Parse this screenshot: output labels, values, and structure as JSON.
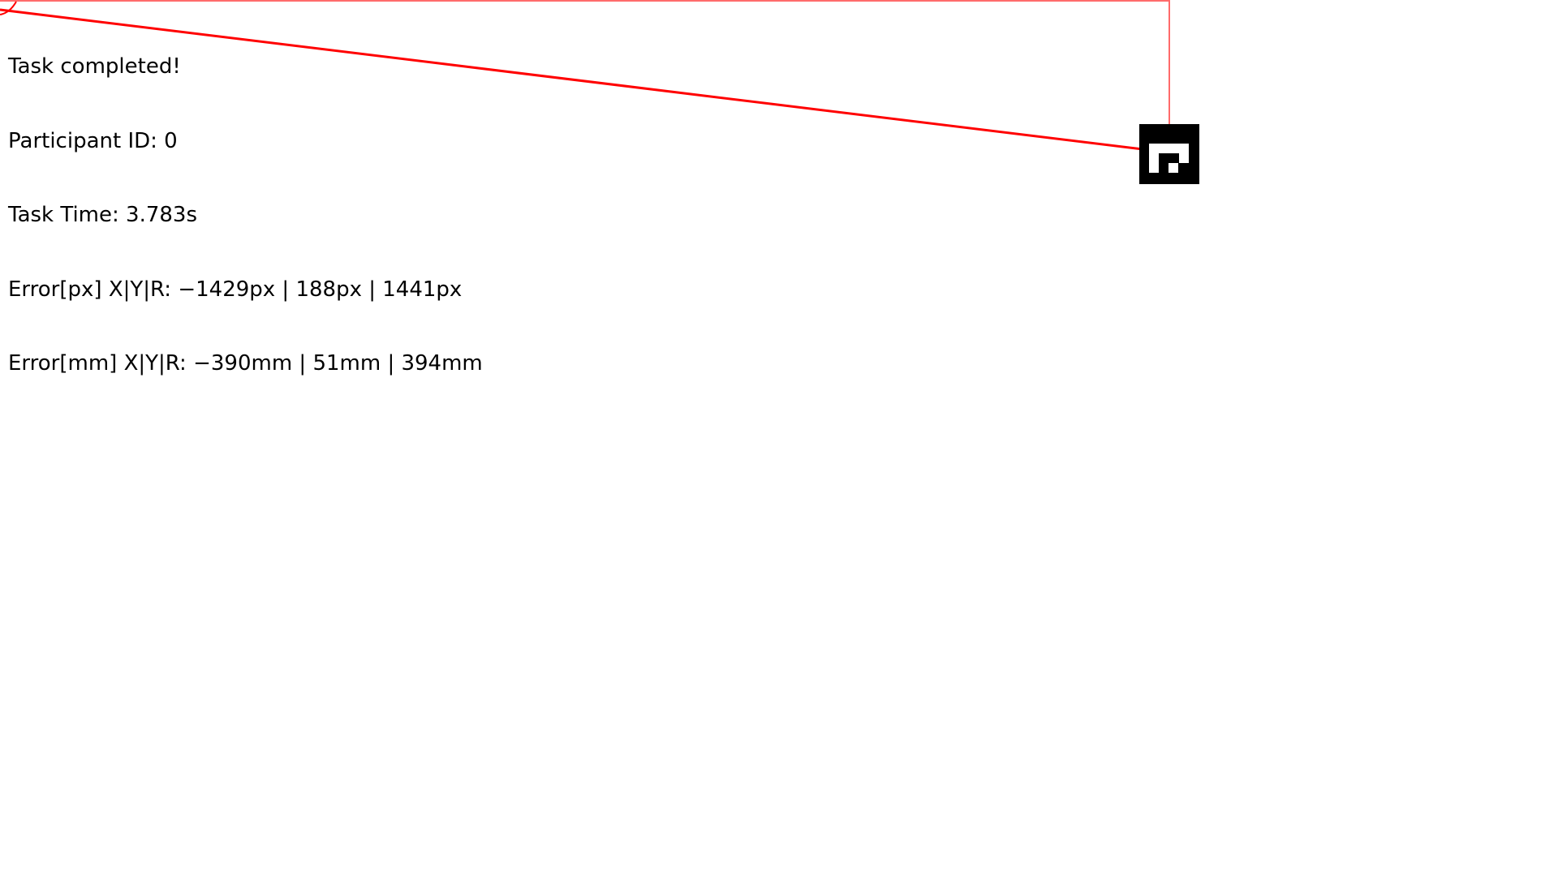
{
  "results": {
    "status": "Task completed!",
    "participant": "Participant ID: 0",
    "task_time": "Task Time: 3.783s",
    "error_px": "Error[px] X|Y|R: −1429px | 188px | 1441px",
    "error_mm": "Error[mm] X|Y|R: −390mm | 51mm | 394mm"
  },
  "overlay": {
    "line_color": "#ff0000",
    "frame_color": "#ff6b6b"
  },
  "marker": {
    "icon": "fiducial-marker-icon"
  }
}
